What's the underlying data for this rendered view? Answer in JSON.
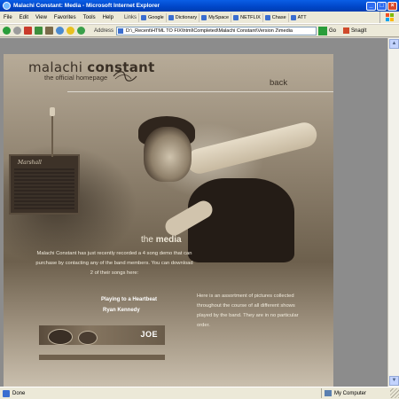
{
  "window": {
    "title": "Malachi Constant: Media - Microsoft Internet Explorer"
  },
  "menu": [
    "File",
    "Edit",
    "View",
    "Favorites",
    "Tools",
    "Help"
  ],
  "links": {
    "label": "Links",
    "items": [
      "Google",
      "Dictionary",
      "MySpace",
      "NETFLIX",
      "Chase",
      "ATT"
    ]
  },
  "address": {
    "label": "Address",
    "value": "D:\\_Recent\\HTML TO FIX\\html\\Completed\\Malachi Constant\\Version 2\\media",
    "go": "Go"
  },
  "snagit": "SnagIt",
  "site": {
    "logo_name_light": "malachi ",
    "logo_name_bold": "constant",
    "logo_sub": "the official homepage",
    "back": "back",
    "amp_brand": "Marshall",
    "media_title_light": "the ",
    "media_title_bold": "media",
    "intro": "Malachi Constant has just recently recorded a 4 song demo that can purchase by contacting any of the band members. You can download 2 of their songs here:",
    "song_title": "Playing to a Heartbeat",
    "song_artist": "Ryan Kennedy",
    "right_text": "Here is an assortment of pictures collected throughout the course of all different shows played by the band. They are in no particular order.",
    "member_label": "JOE"
  },
  "status": {
    "text": "Done",
    "zone": "My Computer"
  },
  "colors": {
    "titlebar": "#0046c8",
    "chrome": "#ece9d8",
    "site_bg": "#e9e3d7",
    "text_dark": "#3a3026",
    "text_light": "#f1ebdd"
  }
}
